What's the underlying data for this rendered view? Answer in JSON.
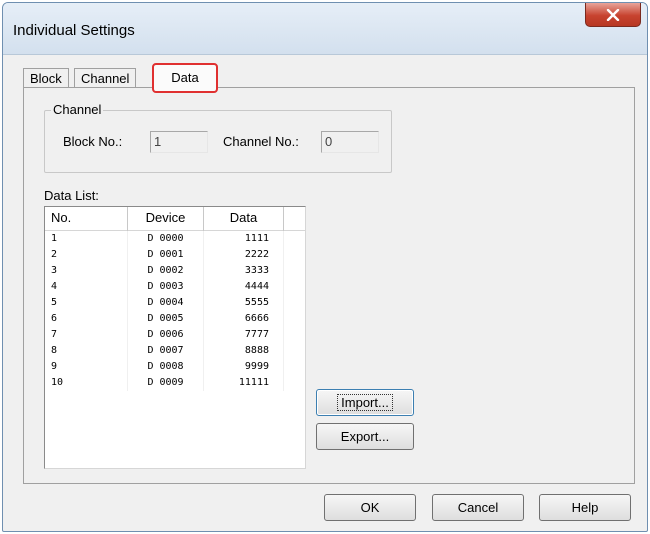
{
  "window": {
    "title": "Individual Settings"
  },
  "tabs": [
    {
      "label": "Block"
    },
    {
      "label": "Channel"
    },
    {
      "label": "Data"
    }
  ],
  "channel_group": {
    "legend": "Channel",
    "block_label": "Block No.:",
    "block_value": "1",
    "channel_label": "Channel No.:",
    "channel_value": "0"
  },
  "data_list": {
    "label": "Data List:",
    "columns": [
      "No.",
      "Device",
      "Data"
    ],
    "rows": [
      [
        "1",
        "D 0000",
        "1111"
      ],
      [
        "2",
        "D 0001",
        "2222"
      ],
      [
        "3",
        "D 0002",
        "3333"
      ],
      [
        "4",
        "D 0003",
        "4444"
      ],
      [
        "5",
        "D 0004",
        "5555"
      ],
      [
        "6",
        "D 0005",
        "6666"
      ],
      [
        "7",
        "D 0006",
        "7777"
      ],
      [
        "8",
        "D 0007",
        "8888"
      ],
      [
        "9",
        "D 0008",
        "9999"
      ],
      [
        "10",
        "D 0009",
        "11111"
      ]
    ]
  },
  "side_buttons": {
    "import": "Import...",
    "export": "Export..."
  },
  "footer_buttons": {
    "ok": "OK",
    "cancel": "Cancel",
    "help": "Help"
  },
  "colors": {
    "highlight": "#e03030",
    "close_button": "#c7432f"
  }
}
